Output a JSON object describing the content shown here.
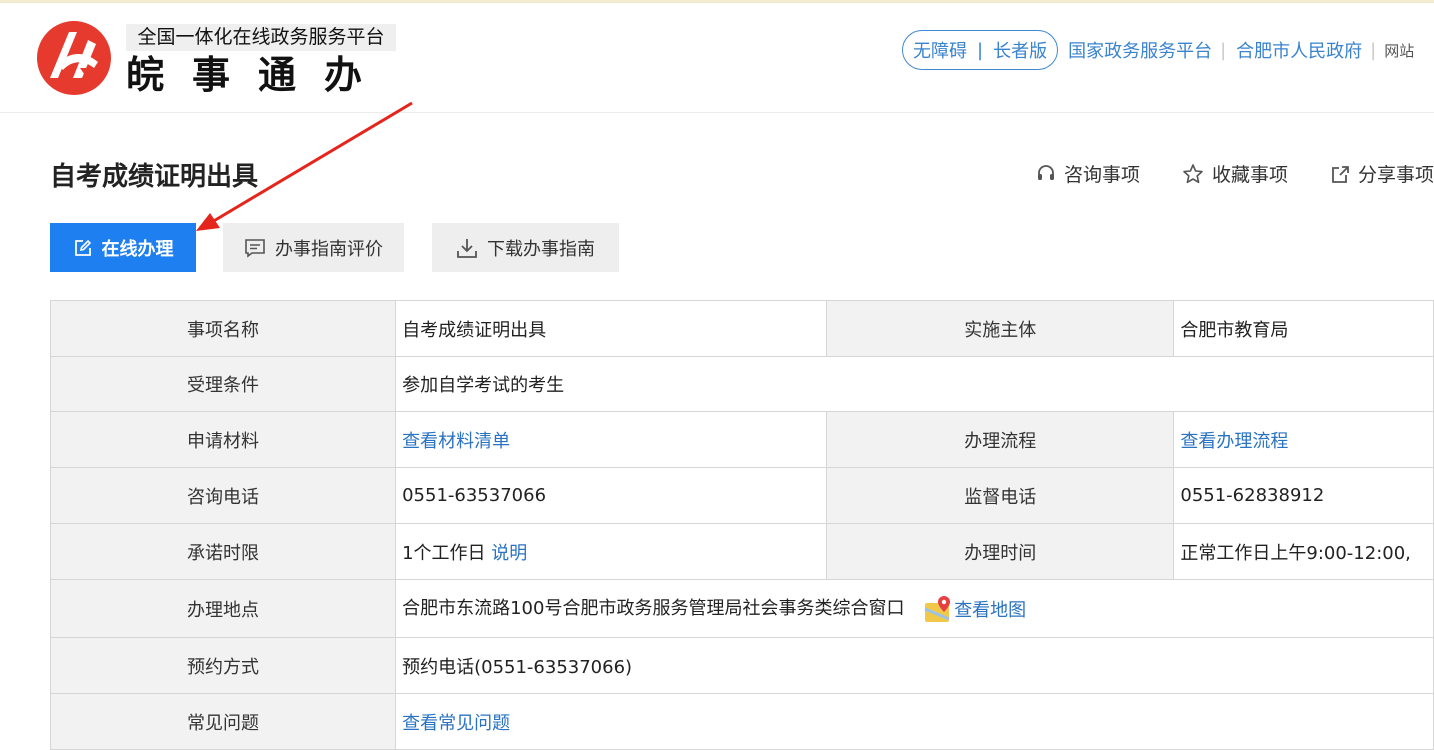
{
  "header": {
    "slogan": "全国一体化在线政务服务平台",
    "brand": "皖事通办",
    "accessibility": "无障碍",
    "elder": "长者版",
    "links": [
      "国家政务服务平台",
      "合肥市人民政府"
    ],
    "truncated": "网站"
  },
  "page": {
    "title": "自考成绩证明出具",
    "actions": [
      "咨询事项",
      "收藏事项",
      "分享事项"
    ]
  },
  "buttons": {
    "online": "在线办理",
    "evaluate": "办事指南评价",
    "download": "下载办事指南"
  },
  "table": {
    "item_name_label": "事项名称",
    "item_name": "自考成绩证明出具",
    "implementer_label": "实施主体",
    "implementer": "合肥市教育局",
    "condition_label": "受理条件",
    "condition": "参加自学考试的考生",
    "materials_label": "申请材料",
    "materials_link": "查看材料清单",
    "process_label": "办理流程",
    "process_link": "查看办理流程",
    "consult_phone_label": "咨询电话",
    "consult_phone": "0551-63537066",
    "supervise_phone_label": "监督电话",
    "supervise_phone": "0551-62838912",
    "time_limit_label": "承诺时限",
    "time_limit": "1个工作日",
    "time_limit_note": "说明",
    "hours_label": "办理时间",
    "hours": "正常工作日上午9:00-12:00,",
    "location_label": "办理地点",
    "location": "合肥市东流路100号合肥市政务服务管理局社会事务类综合窗口",
    "map_link": "查看地图",
    "appointment_label": "预约方式",
    "appointment": "预约电话(0551-63537066)",
    "faq_label": "常见问题",
    "faq_link": "查看常见问题"
  },
  "colors": {
    "primary": "#1e7ff0",
    "link": "#2a73c2",
    "logo_red": "#e63a2e",
    "annotation_arrow": "#e5241c"
  },
  "icons": [
    "logo-icon",
    "edit-icon",
    "comment-icon",
    "download-icon",
    "headset-icon",
    "star-icon",
    "share-icon",
    "map-pin-icon"
  ]
}
